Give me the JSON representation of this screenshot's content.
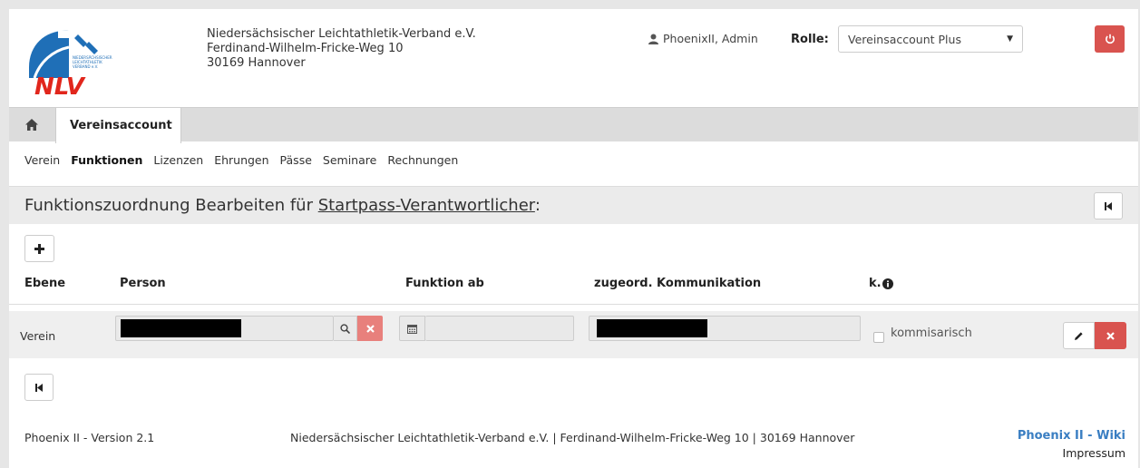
{
  "header": {
    "logo_text": "NLV",
    "logo_small_text": "NIEDERSÄCHSISCHER LEICHTATHLETIK VERBAND e.V.",
    "org_name": "Niedersächsischer Leichtathletik-Verband e.V.",
    "org_street": "Ferdinand-Wilhelm-Fricke-Weg 10",
    "org_city": "30169 Hannover",
    "user_name": "PhoenixII, Admin",
    "role_label": "Rolle:",
    "role_value": "Vereinsaccount Plus"
  },
  "tabs": {
    "active_label": "Vereinsaccount"
  },
  "subnav": [
    "Verein",
    "Funktionen",
    "Lizenzen",
    "Ehrungen",
    "Pässe",
    "Seminare",
    "Rechnungen"
  ],
  "subnav_active": "Funktionen",
  "page": {
    "title_prefix": "Funktionszuordnung Bearbeiten für ",
    "title_link": "Startpass-Verantwortlicher",
    "title_suffix": ":"
  },
  "table": {
    "headers": [
      "Ebene",
      "Person",
      "Funktion ab",
      "zugeord. Kommunikation",
      "k."
    ],
    "rows": [
      {
        "ebene": "Verein",
        "kommisarisch_label": "kommisarisch"
      }
    ]
  },
  "footer": {
    "version": "Phoenix II - Version 2.1",
    "address": "Niedersächsischer Leichtathletik-Verband e.V. | Ferdinand-Wilhelm-Fricke-Weg 10 | 30169 Hannover",
    "wiki": "Phoenix II - Wiki",
    "impressum": "Impressum"
  },
  "colors": {
    "logo_blue": "#1f6fb7",
    "logo_red": "#e1261c",
    "danger": "#d9534f",
    "link": "#3a7ec2"
  }
}
